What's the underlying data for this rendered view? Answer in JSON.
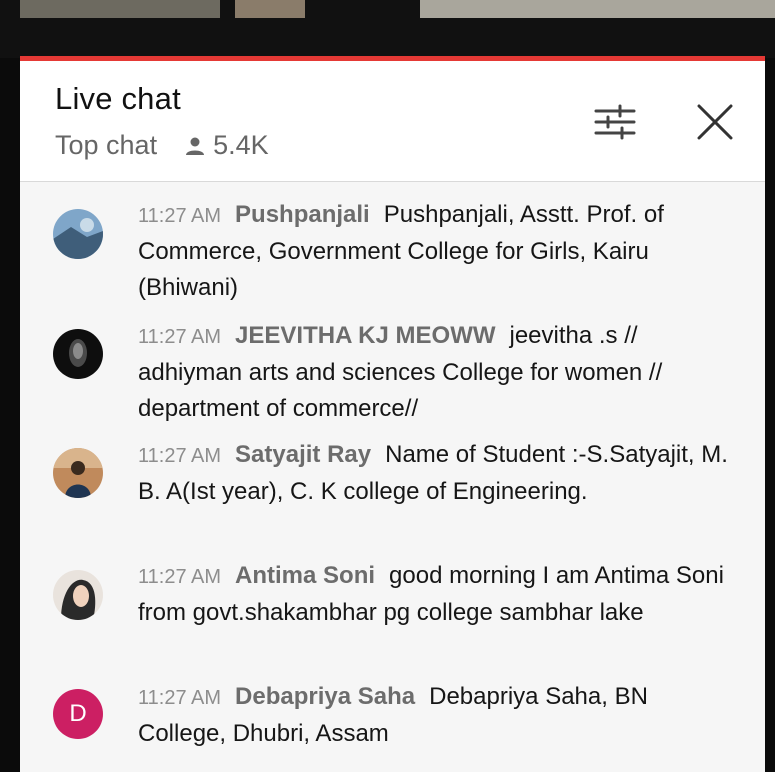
{
  "header": {
    "title": "Live chat",
    "mode": "Top chat",
    "viewer_count": "5.4K",
    "filter_icon": "sliders-icon",
    "close_icon": "close-icon"
  },
  "messages": [
    {
      "time": "11:27 AM",
      "author": "Pushpanjali",
      "text": "Pushpanjali, Asstt. Prof. of Commerce, Government College for Girls, Kairu (Bhiwani)"
    },
    {
      "time": "11:27 AM",
      "author": "JEEVITHA KJ MEOWW",
      "text": "jeevitha .s // adhiyman arts and sciences College for women // department of commerce//"
    },
    {
      "time": "11:27 AM",
      "author": "Satyajit Ray",
      "text": "Name of Student :-S.Satyajit, M. B. A(Ist year), C. K college of Engineering."
    },
    {
      "time": "11:27 AM",
      "author": "Antima Soni",
      "text": "good morning I am Antima Soni from govt.shakambhar pg college sambhar lake"
    },
    {
      "time": "11:27 AM",
      "author": "Debapriya Saha",
      "text": "Debapriya Saha, BN College, Dhubri, Assam",
      "avatar_letter": "D"
    }
  ],
  "colors": {
    "accent": "#e53935",
    "letter_avatar": "#cc1f63"
  }
}
